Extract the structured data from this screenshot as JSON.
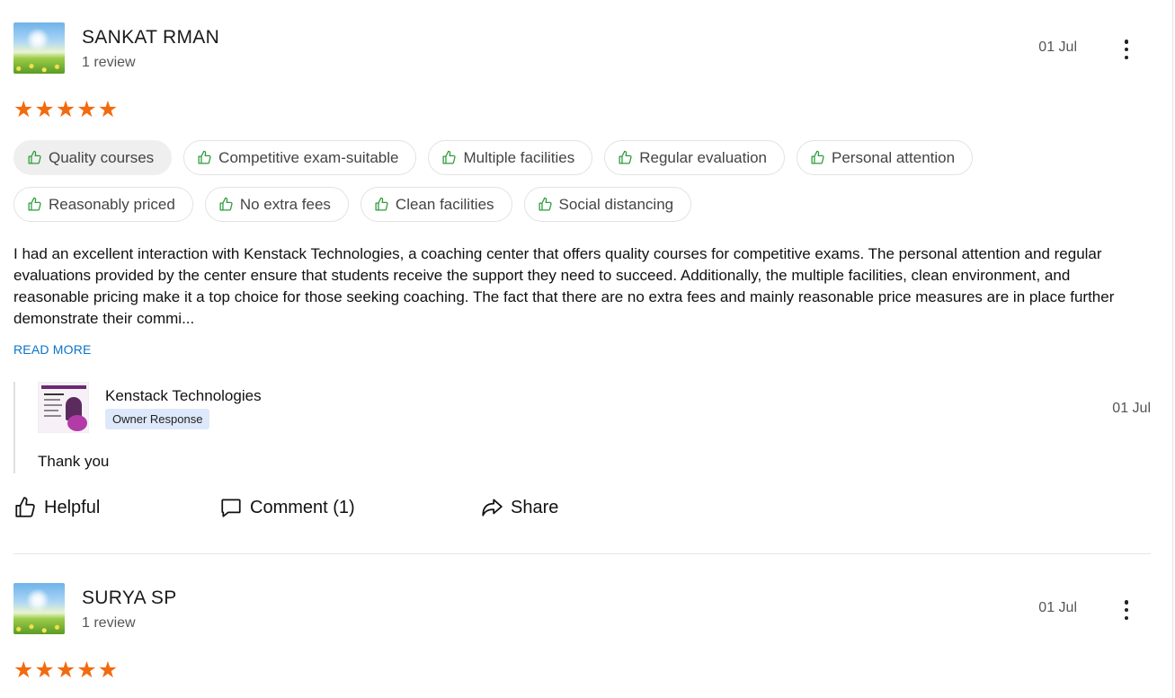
{
  "reviews": [
    {
      "name": "SANKAT RMAN",
      "review_count": "1 review",
      "date": "01 Jul",
      "stars": [
        "★",
        "★",
        "★",
        "★",
        "★"
      ],
      "rating": 5,
      "tags_row1": [
        "Quality courses",
        "Competitive exam-suitable",
        "Multiple facilities",
        "Regular evaluation",
        "Personal attention"
      ],
      "tags_row2": [
        "Reasonably priced",
        "No extra fees",
        "Clean facilities",
        "Social distancing"
      ],
      "text": "I had an excellent interaction with Kenstack Technologies, a coaching center that offers quality courses for competitive exams. The personal attention and regular evaluations provided by the center ensure that students receive the support they need to succeed. Additionally, the multiple facilities, clean environment, and reasonable pricing make it a top choice for those seeking coaching. The fact that there are no extra fees and mainly reasonable price measures are in place further demonstrate their commi...",
      "read_more": "READ MORE",
      "owner": {
        "name": "Kenstack Technologies",
        "badge": "Owner Response",
        "date": "01 Jul",
        "reply": "Thank you"
      },
      "actions": {
        "helpful": "Helpful",
        "comment": "Comment (1)",
        "share": "Share"
      }
    },
    {
      "name": "SURYA SP",
      "review_count": "1 review",
      "date": "01 Jul",
      "stars": [
        "★",
        "★",
        "★",
        "★",
        "★"
      ],
      "rating": 5
    }
  ],
  "colors": {
    "star": "#f26b0f",
    "link": "#0a74c8",
    "thumb_green": "#2e9b3a",
    "owner_badge_bg": "#dde8fb"
  },
  "icons": {
    "tag_icon": "thumbs-up-outline-icon",
    "helpful_icon": "thumbs-up-icon",
    "comment_icon": "speech-bubble-icon",
    "share_icon": "share-arrow-icon",
    "menu_icon": "kebab-menu-icon"
  }
}
